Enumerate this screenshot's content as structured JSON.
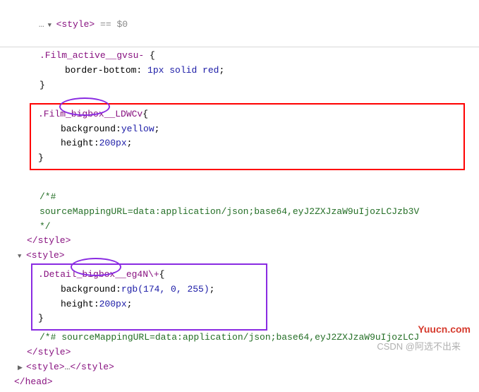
{
  "first_line": {
    "dots": "…",
    "tag_open": "<style>",
    "eq": " == ",
    "dollar": "$0"
  },
  "rule1": {
    "selector": ".Film_active__gvsu-",
    "open_brace": " {",
    "prop": "border-bottom",
    "colon": ": ",
    "value": "1px solid red",
    "semi": ";",
    "close_brace": "}"
  },
  "rule2": {
    "selector": ".Film_bigbox__LDWCv",
    "open_brace": "{",
    "prop1": "background",
    "val1": "yellow",
    "prop2": "height",
    "val2": "200px",
    "close_brace": "}"
  },
  "comment1_open": "/*#",
  "comment1_line2": "sourceMappingURL=data:application/json;base64,eyJ2ZXJzaW9uIjozLCJzb3V",
  "comment1_close": "*/",
  "close_style": "</style>",
  "open_style2": "<style>",
  "rule3": {
    "selector": ".Detail_bigbox__eg4N\\+",
    "open_brace": "{",
    "prop1": "background",
    "func": "rgb",
    "args": "(174, 0, 255)",
    "prop2": "height",
    "val2": "200px",
    "close_brace": "}"
  },
  "comment2": "/*# sourceMappingURL=data:application/json;base64,eyJ2ZXJzaW9uIjozLCJ",
  "close_style2": "</style>",
  "collapsed_style": "<style>",
  "collapsed_ellipsis": "…",
  "collapsed_style_close": "</style>",
  "close_head": "</head>",
  "watermark1": "Yuucn.com",
  "watermark2": "CSDN @阿选不出来"
}
